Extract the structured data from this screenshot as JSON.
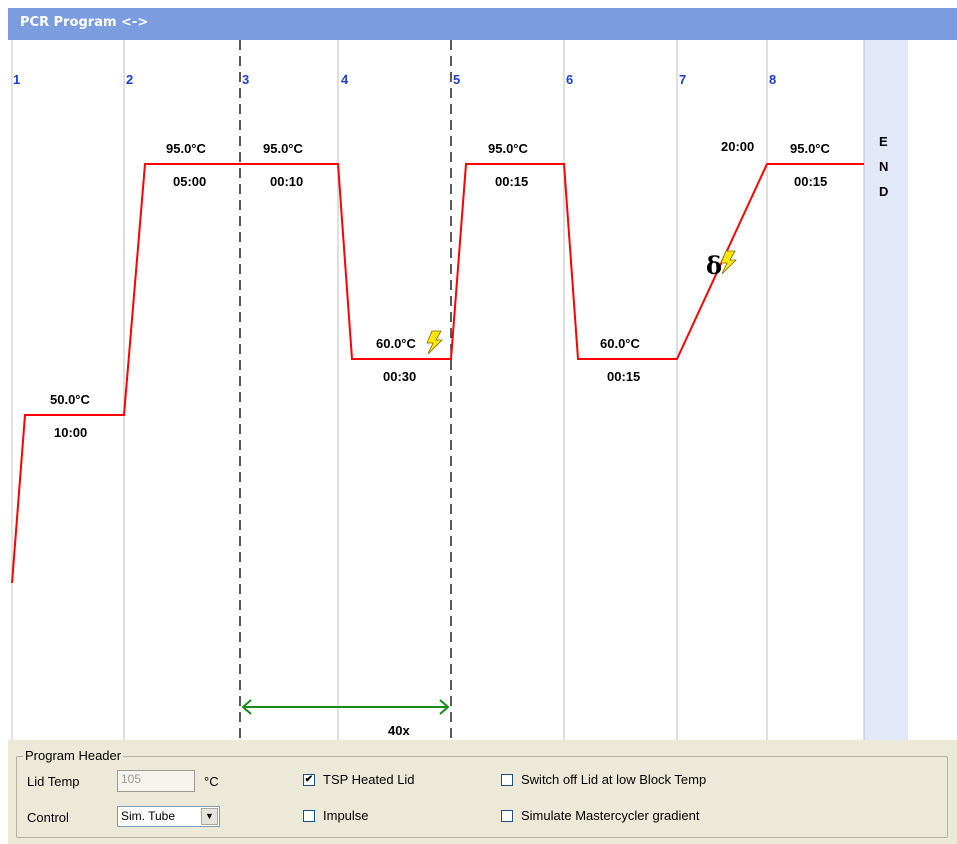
{
  "title": "PCR Program <->",
  "colors": {
    "header": "#7b9de0",
    "line": "#ff0000",
    "step_number": "#1a3fcf",
    "loop_arrow": "#1a8a1a",
    "end_column": "#e2e8f8",
    "panel": "#ece9d8"
  },
  "steps": [
    {
      "number": "1",
      "temp": "50.0°C",
      "time": "10:00"
    },
    {
      "number": "2",
      "temp": "95.0°C",
      "time": "05:00"
    },
    {
      "number": "3",
      "temp": "95.0°C",
      "time": "00:10"
    },
    {
      "number": "4",
      "temp": "60.0°C",
      "time": "00:30",
      "icon": "lightning-icon"
    },
    {
      "number": "5",
      "temp": "95.0°C",
      "time": "00:15"
    },
    {
      "number": "6",
      "temp": "60.0°C",
      "time": "00:15"
    },
    {
      "number": "7",
      "time": "20:00",
      "icon": "delta-lightning-icon"
    },
    {
      "number": "8",
      "temp": "95.0°C",
      "time": "00:15"
    }
  ],
  "end_label": [
    "E",
    "N",
    "D"
  ],
  "loop": {
    "label": "40x",
    "from_step": "3",
    "to_step": "4"
  },
  "program_header": {
    "title": "Program Header",
    "lid_temp_label": "Lid Temp",
    "lid_temp_value": "105",
    "lid_temp_unit": "°C",
    "control_label": "Control",
    "control_value": "Sim. Tube",
    "tsp_heated_lid_label": "TSP Heated Lid",
    "tsp_heated_lid_checked": true,
    "impulse_label": "Impulse",
    "impulse_checked": false,
    "switch_off_lid_label": "Switch off Lid at low Block Temp",
    "switch_off_lid_checked": false,
    "simulate_gradient_label": "Simulate Mastercycler gradient",
    "simulate_gradient_checked": false
  }
}
